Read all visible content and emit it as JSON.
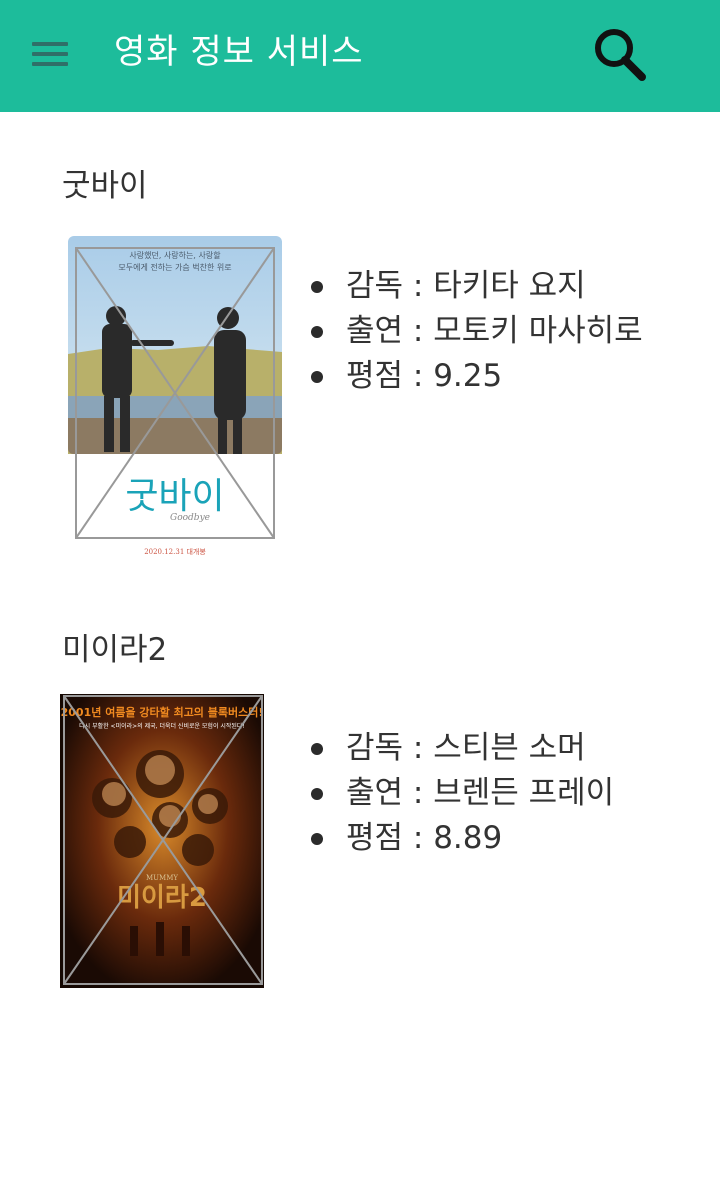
{
  "appbar": {
    "title": "영화 정보 서비스",
    "menu_icon": "hamburger-menu-icon",
    "search_icon": "search-icon",
    "background_color": "#1dbc9b"
  },
  "movies": [
    {
      "title": "굿바이",
      "poster": {
        "tagline_line1": "사랑했던, 사랑하는, 사랑할",
        "tagline_line2": "모두에게 전하는 가슴 벅찬한 위로",
        "logo_text": "굿바이",
        "logo_subtext": "Goodbye",
        "release_text": "2020.12.31 대개봉"
      },
      "details": [
        {
          "label": "감독",
          "value": "타키타 요지"
        },
        {
          "label": "출연",
          "value": "모토키 마사히로"
        },
        {
          "label": "평점",
          "value": "9.25"
        }
      ]
    },
    {
      "title": "미이라2",
      "poster": {
        "headline": "2001년 여름을 강타할 최고의 블록버스터!",
        "subheadline": "다시 부활한 <미이라>의 제국, 더욱더 신비로운 모험이 시작된다!",
        "logo_small": "MUMMY",
        "logo_text": "미이라2"
      },
      "details": [
        {
          "label": "감독",
          "value": "스티븐 소머"
        },
        {
          "label": "출연",
          "value": "브렌든 프레이"
        },
        {
          "label": "평점",
          "value": "8.89"
        }
      ]
    }
  ]
}
